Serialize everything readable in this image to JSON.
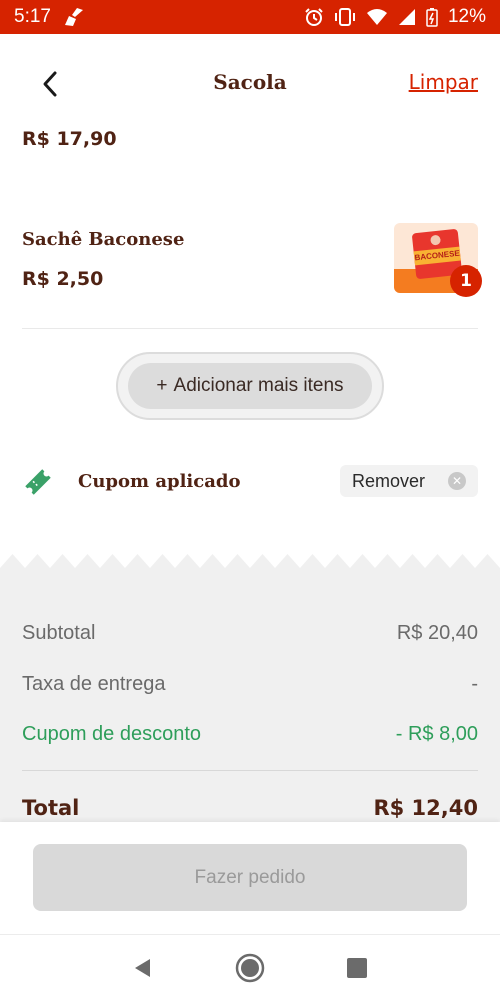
{
  "status_bar": {
    "time": "5:17",
    "battery": "12%",
    "icons": [
      "broom-icon",
      "alarm-icon",
      "vibrate-icon",
      "wifi-icon",
      "signal-icon",
      "battery-icon"
    ]
  },
  "header": {
    "title": "Sacola",
    "clear_label": "Limpar"
  },
  "cart": {
    "previous_item_price": "R$ 17,90",
    "item": {
      "name": "Sachê Baconese",
      "price": "R$ 2,50",
      "quantity": "1",
      "thumb_text": "BACONESE"
    },
    "add_more_label": "Adicionar mais itens",
    "add_more_icon": "+"
  },
  "coupon": {
    "label": "Cupom aplicado",
    "remove_label": "Remover"
  },
  "summary": {
    "subtotal_label": "Subtotal",
    "subtotal_value": "R$ 20,40",
    "delivery_label": "Taxa de entrega",
    "delivery_value": "-",
    "discount_label": "Cupom de desconto",
    "discount_value": "- R$ 8,00",
    "total_label": "Total",
    "total_value": "R$ 12,40"
  },
  "footer": {
    "order_button_label": "Fazer pedido"
  },
  "colors": {
    "brand_red": "#d62300",
    "brand_brown": "#502314",
    "discount_green": "#2e9e5a",
    "disabled_gray": "#d9d9d9"
  }
}
